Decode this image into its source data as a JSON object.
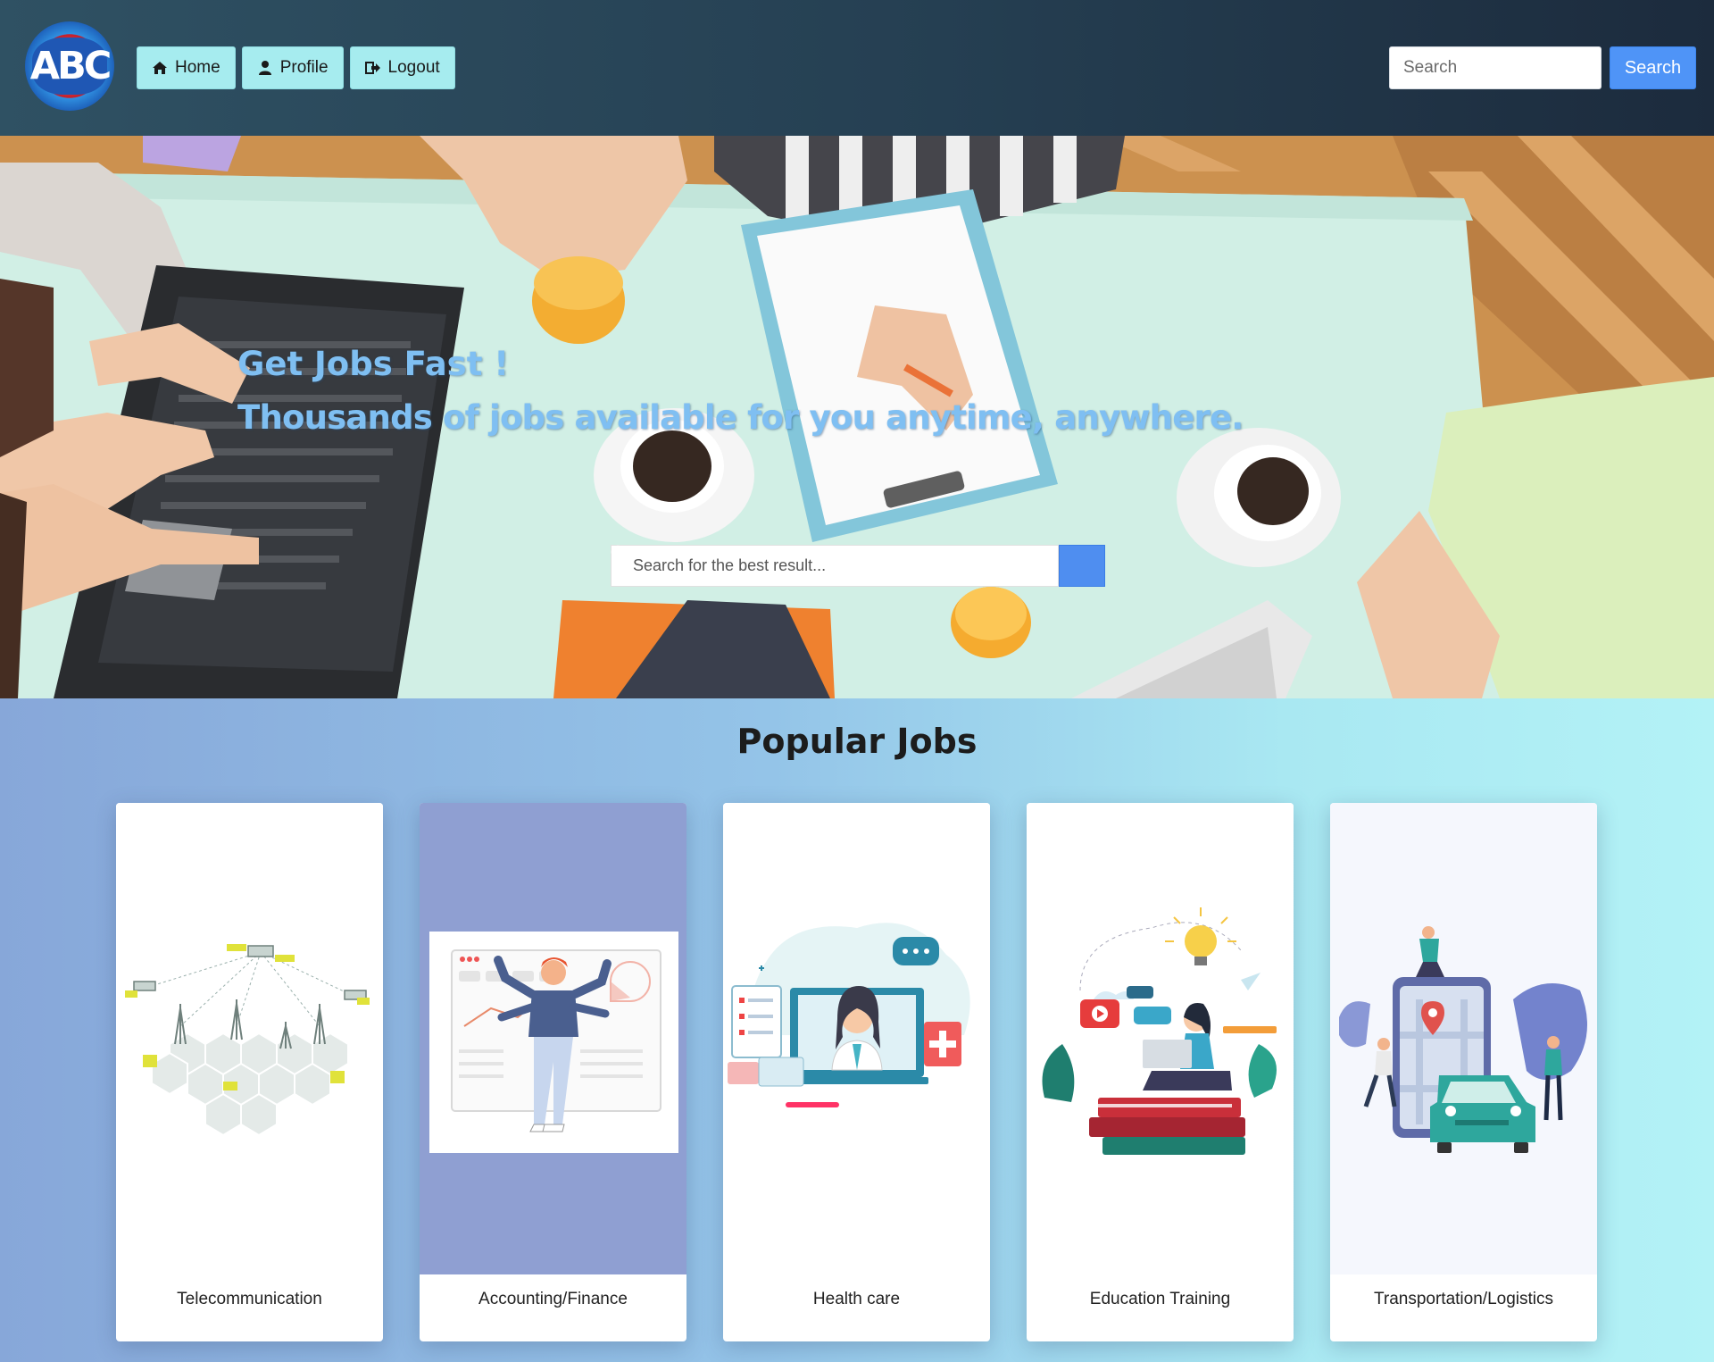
{
  "brand": {
    "logo_text": "ABC"
  },
  "nav": {
    "items": [
      {
        "label": "Home",
        "icon": "home-icon"
      },
      {
        "label": "Profile",
        "icon": "user-icon"
      },
      {
        "label": "Logout",
        "icon": "logout-icon"
      }
    ],
    "search_placeholder": "Search",
    "search_button": "Search"
  },
  "hero": {
    "title": "Get Jobs Fast !",
    "subtitle": "Thousands of jobs available for you anytime, anywhere.",
    "search_placeholder": "Search for the best result...",
    "search_icon": "search-icon"
  },
  "popular": {
    "title": "Popular Jobs",
    "cards": [
      {
        "label": "Telecommunication",
        "illustration": "satellite-network-illustration"
      },
      {
        "label": "Accounting/Finance",
        "illustration": "finance-dashboard-illustration"
      },
      {
        "label": "Health care",
        "illustration": "telemedicine-doctor-illustration"
      },
      {
        "label": "Education Training",
        "illustration": "online-learning-illustration"
      },
      {
        "label": "Transportation/Logistics",
        "illustration": "car-navigation-illustration"
      }
    ]
  },
  "colors": {
    "nav_bg": "#253f52",
    "nav_button": "#a6ecef",
    "primary_button": "#4f94f7",
    "hero_text": "#7fbff2"
  }
}
